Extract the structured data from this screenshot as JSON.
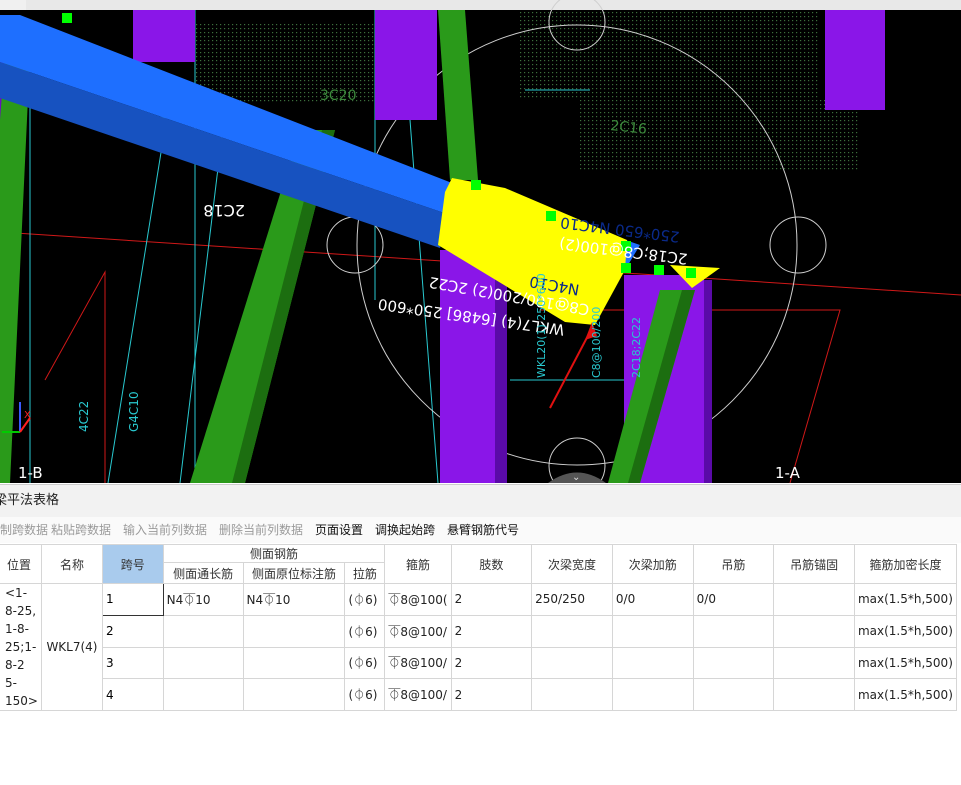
{
  "viewport": {
    "labels": [
      {
        "id": "lbl-2c18-left",
        "text": "2C18"
      },
      {
        "id": "lbl-3c20",
        "text": "3C20"
      },
      {
        "id": "lbl-2c16",
        "text": "2C16"
      },
      {
        "id": "lbl-250x650",
        "text": "250*650 N4C10"
      },
      {
        "id": "lbl-2c18-c8",
        "text": "2C18;C8@100(2)"
      },
      {
        "id": "lbl-n4c10",
        "text": "N4C10"
      },
      {
        "id": "lbl-c8-200",
        "text": "C8@100/200(2) 2C22"
      },
      {
        "id": "lbl-wkl7",
        "text": "WKL7(4) [6486] 250*600"
      },
      {
        "id": "lbl-4c22",
        "text": "4C22"
      },
      {
        "id": "lbl-g4c10",
        "text": "G4C10"
      },
      {
        "id": "lbl-wkl20",
        "text": "WKL20(1) 250*600"
      },
      {
        "id": "lbl-c8-100",
        "text": "C8@100/200"
      },
      {
        "id": "lbl-2c18-2c22",
        "text": "2C18;2C22"
      }
    ],
    "axis_left": "1-B",
    "axis_right": "1-A",
    "colors": {
      "beam_blue": "#1e6fff",
      "column_green": "#2a9a1a",
      "column_purple": "#8a16e8",
      "highlight_yellow": "#ffff00",
      "grip_green": "#00ff00"
    }
  },
  "panel": {
    "title": "梁平法表格"
  },
  "toolbar": {
    "items": [
      {
        "label": "复制跨数据",
        "enabled": false
      },
      {
        "label": "粘贴跨数据",
        "enabled": false
      },
      {
        "label": "输入当前列数据",
        "enabled": false
      },
      {
        "label": "删除当前列数据",
        "enabled": false
      },
      {
        "label": "页面设置",
        "enabled": true
      },
      {
        "label": "调换起始跨",
        "enabled": true
      },
      {
        "label": "悬臂钢筋代号",
        "enabled": true
      }
    ]
  },
  "table": {
    "headers": {
      "position": "位置",
      "name": "名称",
      "span": "跨号",
      "side_group": "侧面钢筋",
      "side_long": "侧面通长筋",
      "side_orig": "侧面原位标注筋",
      "tie": "拉筋",
      "stirrup": "箍筋",
      "legs": "肢数",
      "sec_width": "次梁宽度",
      "sec_add": "次梁加筋",
      "hanger": "吊筋",
      "hanger_anchor": "吊筋锚固",
      "dense_len": "箍筋加密长度"
    },
    "position_text": "<1-8-25,\n1-8-25;1-8-2\n5-\n150>",
    "name_text": "WKL7(4)",
    "rows": [
      {
        "span": "1",
        "side_long": "N4⏁10",
        "side_orig": "N4⏁10",
        "tie": "(⏀6)",
        "stirrup": "⏁8@100(",
        "legs": "2",
        "sec_width": "250/250",
        "sec_add": "0/0",
        "hanger": "0/0",
        "hanger_anchor": "",
        "dense_len": "max(1.5*h,500)"
      },
      {
        "span": "2",
        "side_long": "",
        "side_orig": "",
        "tie": "(⏀6)",
        "stirrup": "⏁8@100/",
        "legs": "2",
        "sec_width": "",
        "sec_add": "",
        "hanger": "",
        "hanger_anchor": "",
        "dense_len": "max(1.5*h,500)"
      },
      {
        "span": "3",
        "side_long": "",
        "side_orig": "",
        "tie": "(⏀6)",
        "stirrup": "⏁8@100/",
        "legs": "2",
        "sec_width": "",
        "sec_add": "",
        "hanger": "",
        "hanger_anchor": "",
        "dense_len": "max(1.5*h,500)"
      },
      {
        "span": "4",
        "side_long": "",
        "side_orig": "",
        "tie": "(⏀6)",
        "stirrup": "⏁8@100/",
        "legs": "2",
        "sec_width": "",
        "sec_add": "",
        "hanger": "",
        "hanger_anchor": "",
        "dense_len": "max(1.5*h,500)"
      }
    ]
  }
}
